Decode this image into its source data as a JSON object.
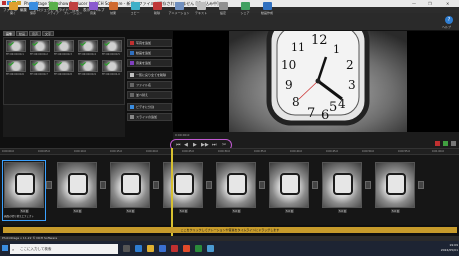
{
  "window": {
    "title": "PhotoStage Slideshow Producer by NCH Software - 新規 - ファイルが保存されていません [読み込み中]",
    "controls": [
      "—",
      "❐",
      "✕"
    ]
  },
  "menu": [
    "ファイル",
    "編集",
    "プロジェクト",
    "スライド",
    "音楽",
    "表示",
    "ヘルプ"
  ],
  "toolbar": [
    {
      "label": "開く",
      "icon": "folder-icon",
      "color": "#e0a030"
    },
    {
      "label": "保存",
      "icon": "save-icon",
      "color": "#3a8de0"
    },
    {
      "label": "メディア",
      "icon": "media-icon",
      "color": "#5ab04a"
    },
    {
      "label": "ナレーション",
      "icon": "mic-icon",
      "color": "#c04040"
    },
    {
      "label": "音楽",
      "icon": "music-icon",
      "color": "#8a5ad0"
    },
    {
      "label": "効果",
      "icon": "effects-icon",
      "color": "#d06a30"
    },
    {
      "label": "コピー",
      "icon": "copy-icon",
      "color": "#3fb0c8"
    },
    {
      "label": "削除",
      "icon": "delete-icon",
      "color": "#c03838"
    },
    {
      "label": "アニメーション",
      "icon": "animation-icon",
      "color": "#7090c0"
    },
    {
      "label": "テキスト",
      "icon": "text-icon",
      "color": "#c0c0c0"
    },
    {
      "label": "設定",
      "icon": "settings-icon",
      "color": "#909090"
    },
    {
      "label": "シェア",
      "icon": "share-icon",
      "color": "#40a060"
    },
    {
      "label": "動画作成",
      "icon": "export-icon",
      "color": "#3070c0"
    }
  ],
  "help": {
    "label": "ヘルプ"
  },
  "media_tabs": [
    "画像",
    "動画",
    "音声",
    "文字"
  ],
  "library": {
    "items": [
      {
        "caption": "TH 00:00:00.1"
      },
      {
        "caption": "TH 00:00:00.2"
      },
      {
        "caption": "TH 00:00:00.3"
      },
      {
        "caption": "TH 00:00:00.4"
      },
      {
        "caption": "TH 00:00:00.5"
      },
      {
        "caption": "TH 00:00:00.6"
      },
      {
        "caption": "TH 00:00:00.7"
      },
      {
        "caption": "TH 00:00:00.8"
      },
      {
        "caption": "TH 00:00:00.9"
      },
      {
        "caption": "TH 00:00:01.0"
      }
    ]
  },
  "actions": [
    {
      "label": "写真を追加",
      "icon_color": "#c03030"
    },
    {
      "label": "動画を追加",
      "icon_color": "#3070c0"
    },
    {
      "label": "音楽を追加",
      "icon_color": "#8040c0"
    },
    {
      "label": "一覧に戻り全てを削除",
      "icon_color": "#c0c0c0"
    },
    {
      "label": "ファイル名",
      "icon_color": "#666666"
    },
    {
      "label": "並べ替え",
      "icon_color": "#666666"
    },
    {
      "label": "ビデオに分割",
      "icon_color": "#3a8de0"
    },
    {
      "label": "スライドの追加",
      "icon_color": "#888888"
    }
  ],
  "preview_toolbar": {
    "time": "0:00:00.0",
    "buttons": [
      "⏮",
      "◀",
      "▶",
      "▶▶",
      "⏭",
      "✂"
    ]
  },
  "ruler": [
    "0:00:00.0",
    "0:00:05.0",
    "0:00:10.0",
    "0:00:15.0",
    "0:00:20.0",
    "0:00:25.0",
    "0:00:30.0",
    "0:00:35.0",
    "0:00:40.0",
    "0:00:45.0",
    "0:00:50.0",
    "0:00:55.0",
    "0:01:00.0"
  ],
  "timeline": {
    "clips": [
      {
        "duration": "5.0 秒"
      },
      {
        "duration": "5.0 秒"
      },
      {
        "duration": "5.0 秒"
      },
      {
        "duration": "5.0 秒"
      },
      {
        "duration": "5.0 秒"
      },
      {
        "duration": "5.0 秒"
      },
      {
        "duration": "5.0 秒"
      },
      {
        "duration": "5.0 秒"
      }
    ],
    "selected_label": "画面の切り替えエフェクト"
  },
  "banner": "ここをクリックしてナレーションや音楽をタイムラインにドラッグします",
  "status": "PhotoStage v 11.22 © NCH Software",
  "taskbar": {
    "search_placeholder": "ここに入力して検索",
    "clock_time": "19:09",
    "clock_date": "2024/05/01"
  }
}
